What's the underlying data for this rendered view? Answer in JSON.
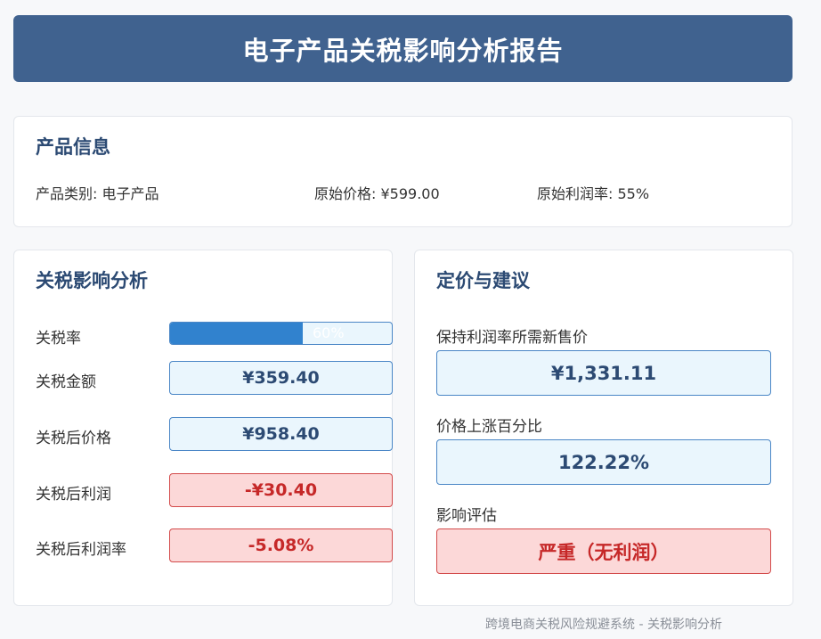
{
  "header": {
    "title": "电子产品关税影响分析报告"
  },
  "product_info": {
    "title": "产品信息",
    "category": "产品类别: 电子产品",
    "original_price": "原始价格: ¥599.00",
    "original_margin": "原始利润率: 55%"
  },
  "tariff_analysis": {
    "title": "关税影响分析",
    "rate_label": "关税率",
    "rate_percent": 60,
    "rate_text": "60%",
    "amount_label": "关税金额",
    "amount_value": "¥359.40",
    "post_price_label": "关税后价格",
    "post_price_value": "¥958.40",
    "post_profit_label": "关税后利润",
    "post_profit_value": "-¥30.40",
    "post_margin_label": "关税后利润率",
    "post_margin_value": "-5.08%"
  },
  "pricing": {
    "title": "定价与建议",
    "new_price_label": "保持利润率所需新售价",
    "new_price_value": "¥1,331.11",
    "increase_label": "价格上涨百分比",
    "increase_value": "122.22%",
    "assessment_label": "影响评估",
    "assessment_value": "严重（无利润）"
  },
  "footer": {
    "text": "跨境电商关税风险规避系统 - 关税影响分析"
  },
  "colors": {
    "header_bg": "#40628f",
    "accent_blue": "#3182ce",
    "danger_red": "#c62828"
  }
}
